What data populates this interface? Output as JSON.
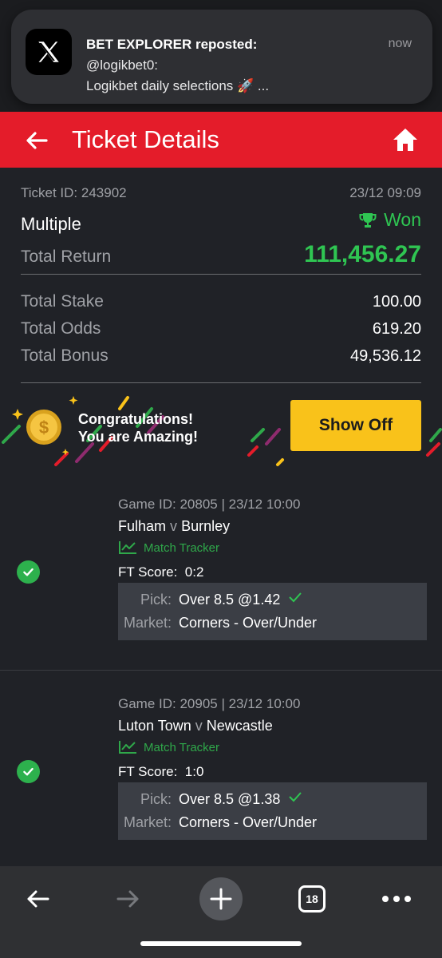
{
  "notification": {
    "app_icon": "x-logo-icon",
    "title": "BET EXPLORER reposted:",
    "line1": "@logikbet0:",
    "line2": "Logikbet daily selections 🚀 ...",
    "time": "now"
  },
  "header": {
    "title": "Ticket Details",
    "back_icon": "back-arrow-icon",
    "home_icon": "home-icon",
    "color": "#e41c2a"
  },
  "ticket": {
    "id_label": "Ticket ID: 243902",
    "date": "23/12 09:09",
    "type": "Multiple",
    "status": "Won",
    "total_return_label": "Total Return",
    "total_return": "111,456.27",
    "total_stake_label": "Total Stake",
    "total_stake": "100.00",
    "total_odds_label": "Total Odds",
    "total_odds": "619.20",
    "total_bonus_label": "Total Bonus",
    "total_bonus": "49,536.12"
  },
  "banner": {
    "line1": "Congratulations!",
    "line2": "You are Amazing!",
    "button": "Show Off"
  },
  "selections": [
    {
      "game_id": "Game ID: 20805 | 23/12 10:00",
      "home": "Fulham",
      "vs": "v",
      "away": "Burnley",
      "tracker": "Match Tracker",
      "ft_label": "FT Score:",
      "ft_score": "0:2",
      "pick_label": "Pick:",
      "pick": "Over 8.5 @1.42",
      "market_label": "Market:",
      "market": "Corners - Over/Under"
    },
    {
      "game_id": "Game ID: 20905 | 23/12 10:00",
      "home": "Luton Town",
      "vs": "v",
      "away": "Newcastle",
      "tracker": "Match Tracker",
      "ft_label": "FT Score:",
      "ft_score": "1:0",
      "pick_label": "Pick:",
      "pick": "Over 8.5 @1.38",
      "market_label": "Market:",
      "market": "Corners - Over/Under"
    }
  ],
  "browser_bar": {
    "tabs_count": "18"
  },
  "colors": {
    "background": "#202227",
    "won_green": "#2fc552",
    "show_off_yellow": "#f9c21a"
  }
}
